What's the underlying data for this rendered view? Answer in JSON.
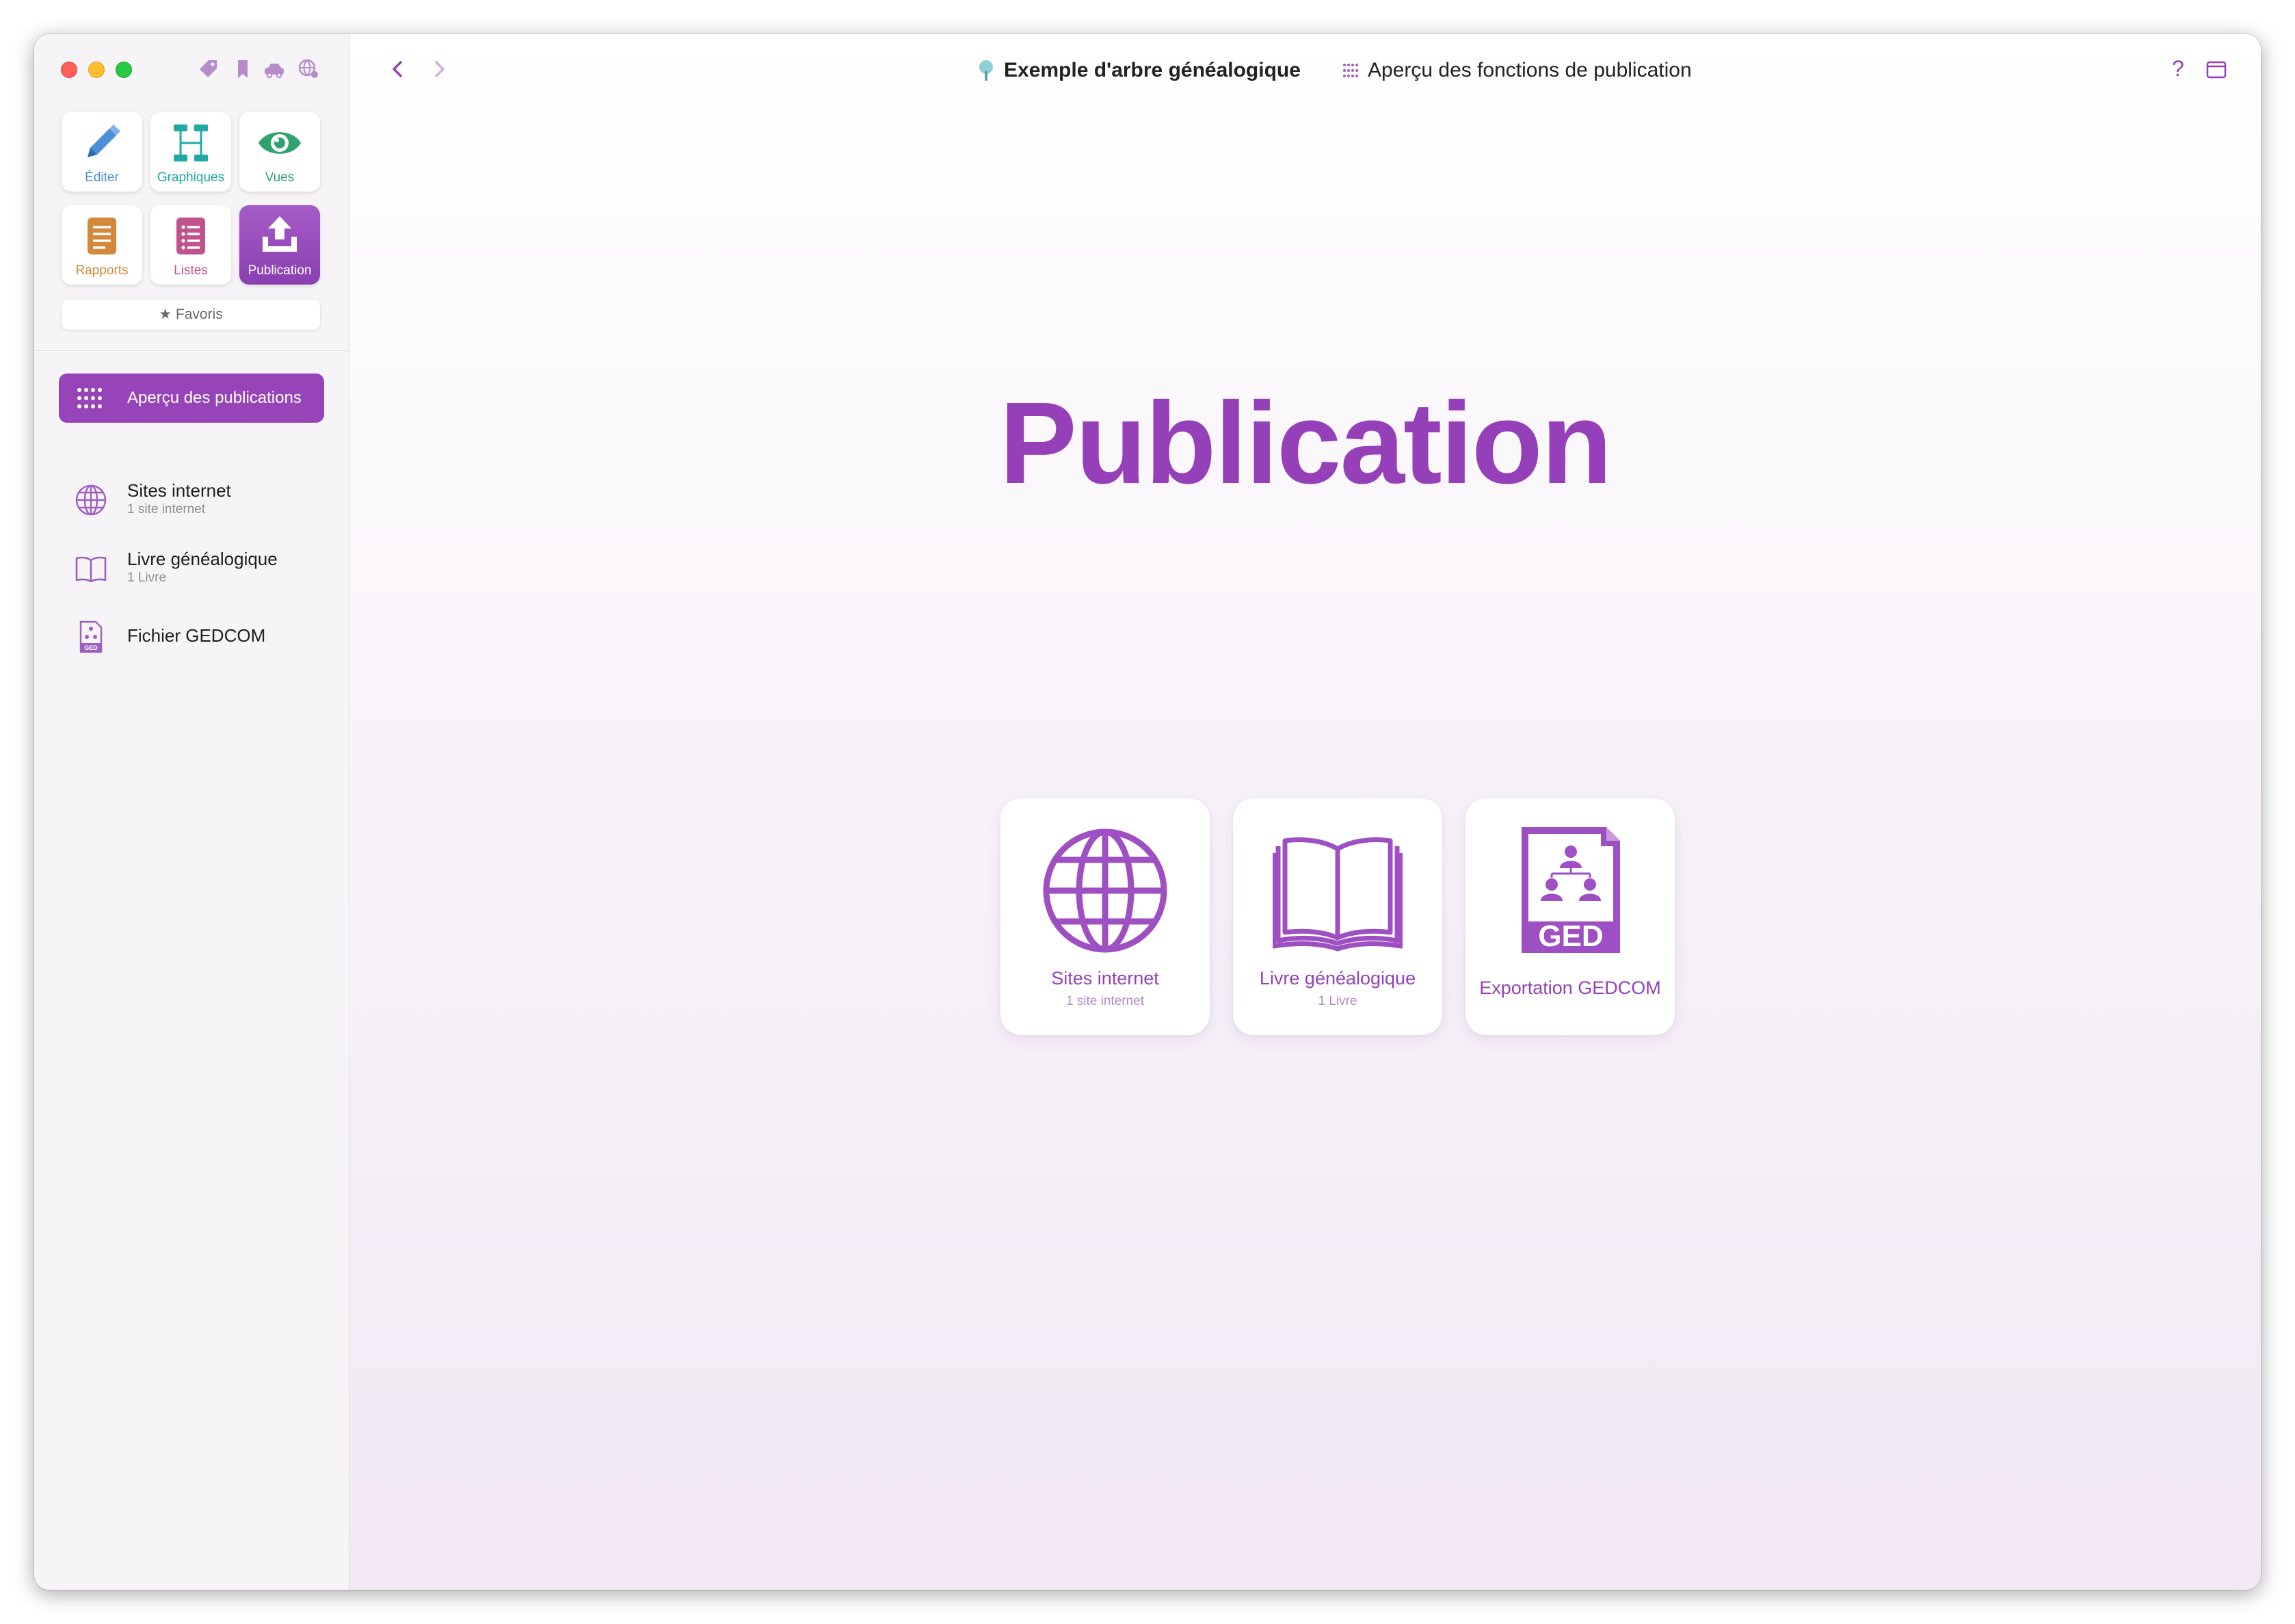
{
  "colors": {
    "accent": "#9744b9",
    "edit": "#4a90d9",
    "charts": "#1fa9a5",
    "views": "#2fa36f",
    "reports": "#d4893a",
    "lists": "#c0528c"
  },
  "toolbar": {
    "document_title": "Exemple d'arbre généalogique",
    "view_title": "Aperçu des fonctions de publication",
    "help_label": "?"
  },
  "modules": [
    {
      "label": "Éditer",
      "icon": "pencil-icon"
    },
    {
      "label": "Graphiques",
      "icon": "chart-tree-icon"
    },
    {
      "label": "Vues",
      "icon": "eye-icon"
    },
    {
      "label": "Rapports",
      "icon": "report-icon"
    },
    {
      "label": "Listes",
      "icon": "list-icon"
    },
    {
      "label": "Publication",
      "icon": "upload-tray-icon",
      "active": true
    }
  ],
  "favorites_label": "Favoris",
  "sidebar": {
    "selected": {
      "label": "Aperçu des publications",
      "icon": "grid-dots-icon"
    },
    "items": [
      {
        "title": "Sites internet",
        "subtitle": "1 site internet",
        "icon": "globe-icon"
      },
      {
        "title": "Livre généalogique",
        "subtitle": "1 Livre",
        "icon": "book-icon"
      },
      {
        "title": "Fichier GEDCOM",
        "subtitle": "",
        "icon": "gedcom-file-icon"
      }
    ]
  },
  "main": {
    "heading": "Publication",
    "cards": [
      {
        "title": "Sites internet",
        "subtitle": "1 site internet",
        "icon": "globe-icon"
      },
      {
        "title": "Livre généalogique",
        "subtitle": "1 Livre",
        "icon": "book-icon"
      },
      {
        "title": "Exportation GEDCOM",
        "subtitle": "",
        "icon": "gedcom-file-icon",
        "badge": "GED"
      }
    ]
  }
}
